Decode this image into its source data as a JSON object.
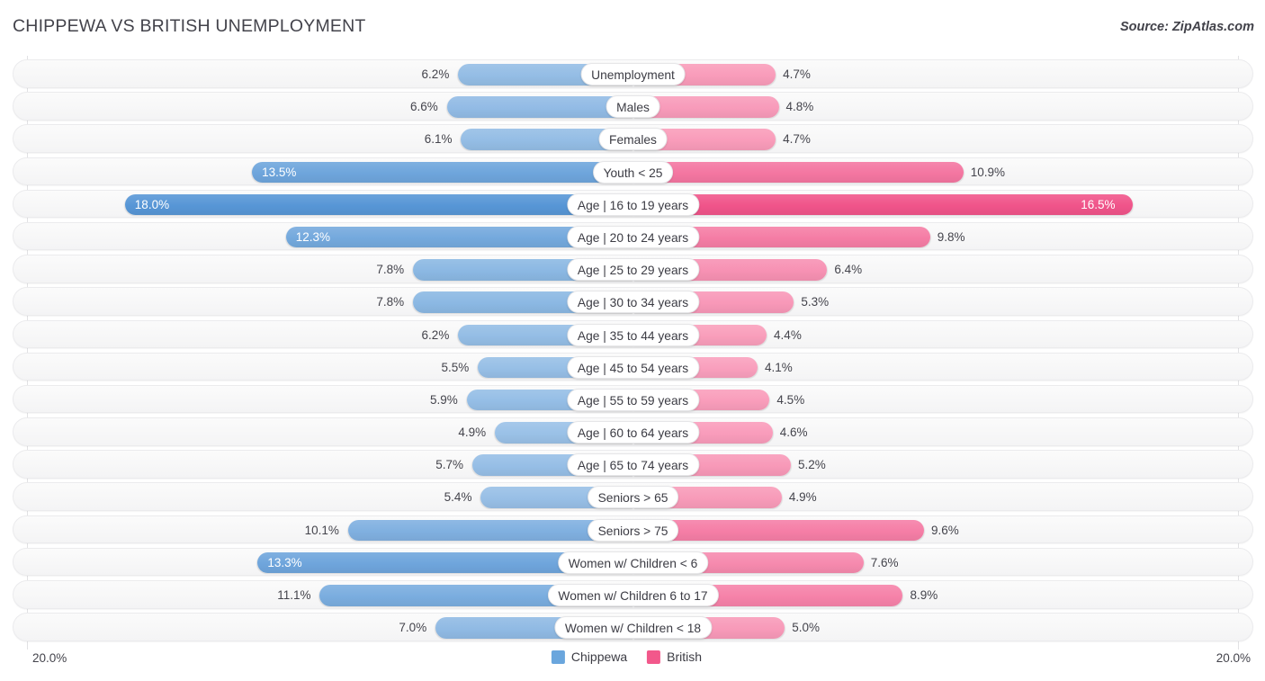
{
  "header": {
    "title": "CHIPPEWA VS BRITISH UNEMPLOYMENT",
    "source": "Source: ZipAtlas.com"
  },
  "axis": {
    "left_label": "20.0%",
    "right_label": "20.0%"
  },
  "legend": [
    {
      "label": "Chippewa",
      "color": "#6aa6dd"
    },
    {
      "label": "British",
      "color": "#f2588b"
    }
  ],
  "chart_data": {
    "type": "bar",
    "title": "CHIPPEWA VS BRITISH UNEMPLOYMENT",
    "orientation": "horizontal-diverging",
    "xlabel": "",
    "ylabel": "",
    "xlim": [
      20.0,
      20.0
    ],
    "axis_max": 20.0,
    "grid": true,
    "legend_position": "bottom-center",
    "categories": [
      "Unemployment",
      "Males",
      "Females",
      "Youth < 25",
      "Age | 16 to 19 years",
      "Age | 20 to 24 years",
      "Age | 25 to 29 years",
      "Age | 30 to 34 years",
      "Age | 35 to 44 years",
      "Age | 45 to 54 years",
      "Age | 55 to 59 years",
      "Age | 60 to 64 years",
      "Age | 65 to 74 years",
      "Seniors > 65",
      "Seniors > 75",
      "Women w/ Children < 6",
      "Women w/ Children 6 to 17",
      "Women w/ Children < 18"
    ],
    "series": [
      {
        "name": "Chippewa",
        "side": "left",
        "color": "#6aa6dd",
        "values": [
          6.2,
          6.6,
          6.1,
          13.5,
          18.0,
          12.3,
          7.8,
          7.8,
          6.2,
          5.5,
          5.9,
          4.9,
          5.7,
          5.4,
          10.1,
          13.3,
          11.1,
          7.0
        ],
        "labels": [
          "6.2%",
          "6.6%",
          "6.1%",
          "13.5%",
          "18.0%",
          "12.3%",
          "7.8%",
          "7.8%",
          "6.2%",
          "5.5%",
          "5.9%",
          "4.9%",
          "5.7%",
          "5.4%",
          "10.1%",
          "13.3%",
          "11.1%",
          "7.0%"
        ]
      },
      {
        "name": "British",
        "side": "right",
        "color": "#f2588b",
        "values": [
          4.7,
          4.8,
          4.7,
          10.9,
          16.5,
          9.8,
          6.4,
          5.3,
          4.4,
          4.1,
          4.5,
          4.6,
          5.2,
          4.9,
          9.6,
          7.6,
          8.9,
          5.0
        ],
        "labels": [
          "4.7%",
          "4.8%",
          "4.7%",
          "10.9%",
          "16.5%",
          "9.8%",
          "6.4%",
          "5.3%",
          "4.4%",
          "4.1%",
          "4.5%",
          "4.6%",
          "5.2%",
          "4.9%",
          "9.6%",
          "7.6%",
          "8.9%",
          "5.0%"
        ]
      }
    ]
  }
}
